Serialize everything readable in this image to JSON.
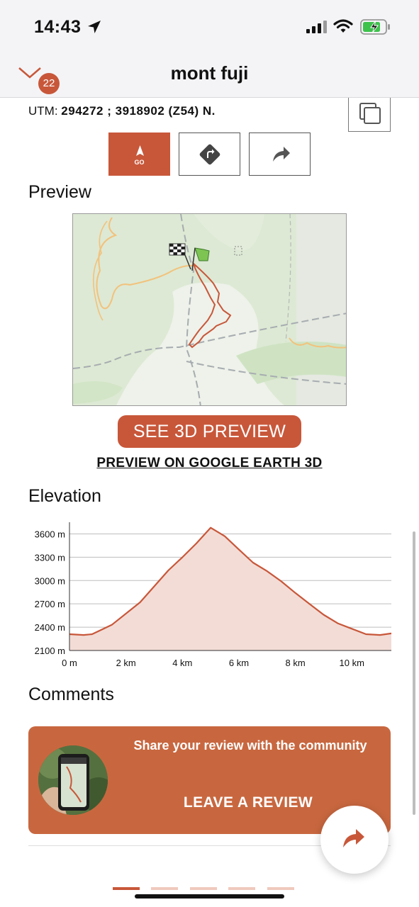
{
  "status_bar": {
    "time": "14:43"
  },
  "nav": {
    "title": "mont fuji",
    "badge_count": "22"
  },
  "utm": {
    "label": "UTM:",
    "value": "294272 ; 3918902 (Z54) N."
  },
  "actions": {
    "go_label": "GO"
  },
  "preview": {
    "heading": "Preview",
    "see_3d_label": "SEE 3D PREVIEW",
    "google_earth_link": "PREVIEW ON GOOGLE EARTH 3D"
  },
  "elevation": {
    "heading": "Elevation"
  },
  "chart_data": {
    "type": "area",
    "title": "",
    "xlabel": "",
    "ylabel": "",
    "x_unit": "km",
    "y_unit": "m",
    "xlim": [
      0,
      11.4
    ],
    "ylim": [
      2100,
      3750
    ],
    "x_ticks": [
      "0 m",
      "2 km",
      "4 km",
      "6 km",
      "8 km",
      "10 km"
    ],
    "x_tick_values": [
      0,
      2,
      4,
      6,
      8,
      10
    ],
    "y_ticks": [
      "2100 m",
      "2400 m",
      "2700 m",
      "3000 m",
      "3300 m",
      "3600 m"
    ],
    "y_tick_values": [
      2100,
      2400,
      2700,
      3000,
      3300,
      3600
    ],
    "grid": true,
    "fill_color": "#f3dcd6",
    "line_color": "#c8573a",
    "series": [
      {
        "x": [
          0,
          0.5,
          0.8,
          1.5,
          2.5,
          3.5,
          4.0,
          4.5,
          5.0,
          5.5,
          6.0,
          6.5,
          7.0,
          7.5,
          8.0,
          8.5,
          9.0,
          9.5,
          10.0,
          10.5,
          11.0,
          11.4
        ],
        "values": [
          2310,
          2300,
          2310,
          2430,
          2720,
          3130,
          3300,
          3480,
          3680,
          3570,
          3400,
          3230,
          3120,
          2990,
          2840,
          2700,
          2560,
          2450,
          2380,
          2310,
          2300,
          2320
        ]
      }
    ]
  },
  "comments": {
    "heading": "Comments",
    "share_text": "Share your review with the community",
    "cta_label": "LEAVE A REVIEW"
  },
  "colors": {
    "accent": "#c8573a",
    "card": "#c8673f"
  },
  "icons": {
    "location": "location-arrow-icon",
    "copy": "copy-icon",
    "go": "go-navigation-icon",
    "directions": "directions-icon",
    "share": "share-arrow-icon"
  }
}
